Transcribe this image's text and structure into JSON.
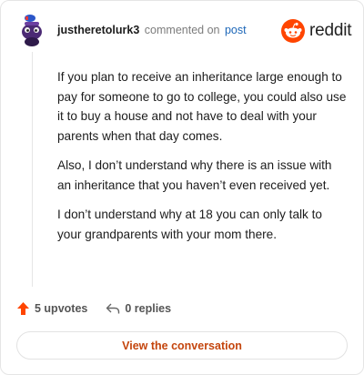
{
  "header": {
    "username": "justheretolurk3",
    "action_text": "commented on",
    "post_link": "post",
    "brand": "reddit"
  },
  "comment": {
    "paragraphs": [
      "If you plan to receive an inheritance large enough to pay for someone to go to college, you could also use it to buy a house and not have to deal with your parents when that day comes.",
      "Also, I don’t understand why there is an issue with an inheritance that you haven’t even received yet.",
      "I don’t understand why at 18 you can only talk to your grandparents with your mom there."
    ]
  },
  "actions": {
    "upvotes": "5 upvotes",
    "replies": "0 replies"
  },
  "cta": {
    "label": "View the conversation"
  },
  "colors": {
    "upvote": "#ff4500",
    "link": "#1d67b8",
    "cta_text": "#c4450d",
    "brand": "#ff4500"
  },
  "icons": {
    "avatar": "snoo-avatar",
    "brand": "reddit-snoo-icon",
    "upvote": "upvote-arrow-icon",
    "reply": "reply-arrow-icon"
  }
}
